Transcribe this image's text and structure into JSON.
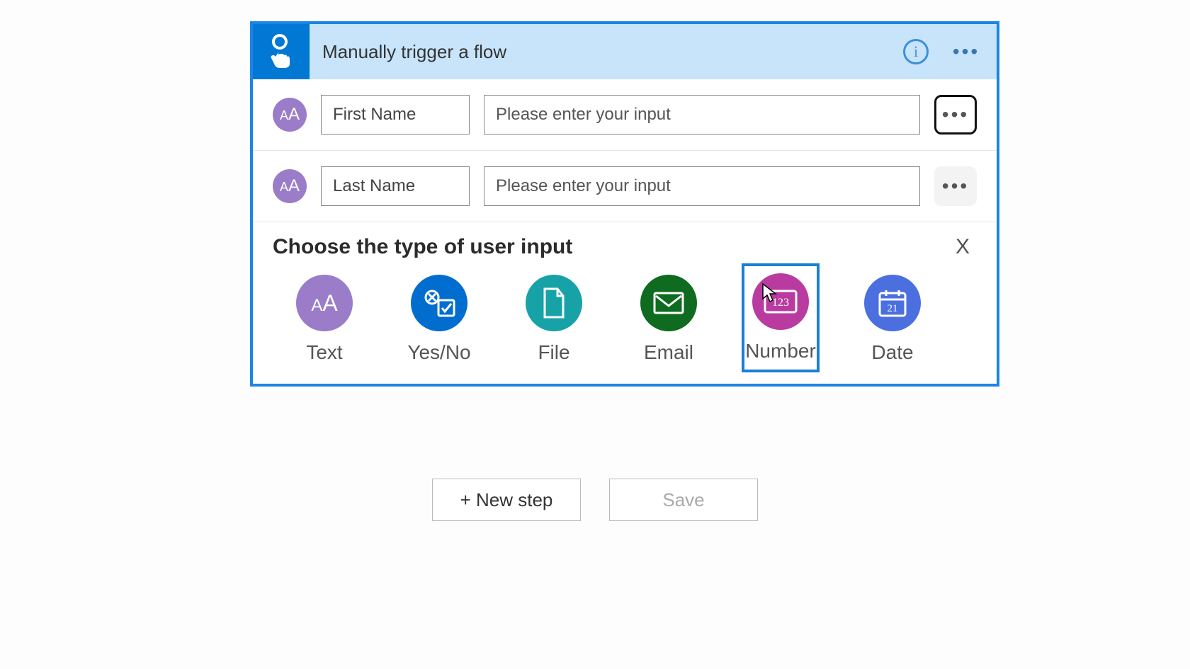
{
  "trigger": {
    "title": "Manually trigger a flow",
    "inputs": [
      {
        "name": "First Name",
        "placeholder": "Please enter your input"
      },
      {
        "name": "Last Name",
        "placeholder": "Please enter your input"
      }
    ],
    "choose_label": "Choose the type of user input",
    "close_label": "X",
    "types": {
      "text": "Text",
      "yesno": "Yes/No",
      "file": "File",
      "email": "Email",
      "number": "Number",
      "date": "Date"
    }
  },
  "actions": {
    "new_step": "+ New step",
    "save": "Save"
  }
}
